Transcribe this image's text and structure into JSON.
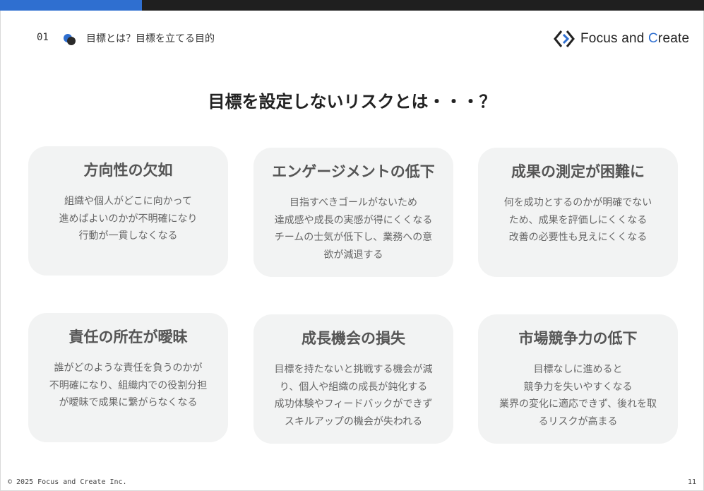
{
  "header": {
    "section_number": "01",
    "section_title": "目標とは？目標を立てる目的",
    "logo_text_prefix": "Focus and ",
    "logo_text_c": "C",
    "logo_text_suffix": "reate"
  },
  "colors": {
    "accent_blue": "#2f6fd0",
    "top_bar_dark": "#1f1f1f",
    "card_bg": "#f2f3f3"
  },
  "slide": {
    "title": "目標を設定しないリスクとは・・・？"
  },
  "cards": [
    {
      "title": "方向性の欠如",
      "lines": [
        "組織や個人がどこに向かって",
        "進めばよいのかが不明確になり",
        "行動が一貫しなくなる"
      ]
    },
    {
      "title": "エンゲージメントの低下",
      "lines": [
        "目指すべきゴールがないため",
        "達成感や成長の実感が得にくくなる",
        "チームの士気が低下し、業務への意",
        "欲が減退する"
      ]
    },
    {
      "title": "成果の測定が困難に",
      "lines": [
        "何を成功とするのかが明確でない",
        "ため、成果を評価しにくくなる",
        "改善の必要性も見えにくくなる"
      ]
    },
    {
      "title": "責任の所在が曖昧",
      "lines": [
        "誰がどのような責任を負うのかが",
        "不明確になり、組織内での役割分担",
        "が曖昧で成果に繋がらなくなる"
      ]
    },
    {
      "title": "成長機会の損失",
      "lines": [
        "目標を持たないと挑戦する機会が減",
        "り、個人や組織の成長が鈍化する",
        "成功体験やフィードバックができず",
        "スキルアップの機会が失われる"
      ]
    },
    {
      "title": "市場競争力の低下",
      "lines": [
        "目標なしに進めると",
        "競争力を失いやすくなる",
        "業界の変化に適応できず、後れを取",
        "るリスクが高まる"
      ]
    }
  ],
  "footer": {
    "copyright": "© 2025 Focus and Create Inc.",
    "page_number": "11"
  }
}
